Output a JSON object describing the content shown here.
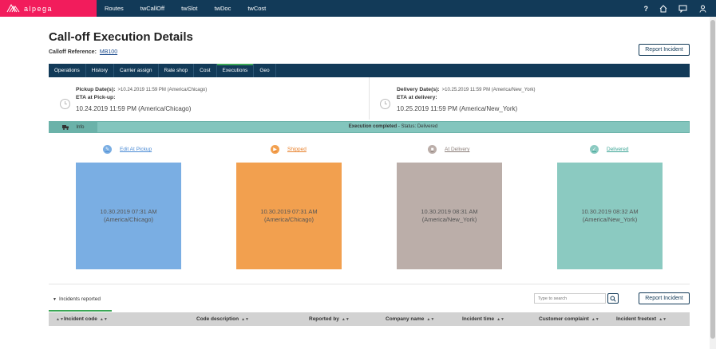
{
  "brand": {
    "name": "alpega",
    "color": "#f21c5c"
  },
  "topnav": {
    "items": [
      "Routes",
      "twCallOff",
      "twSlot",
      "twDoc",
      "twCost"
    ]
  },
  "topicons": [
    "help-icon",
    "home-icon",
    "messages-icon",
    "user-icon"
  ],
  "page": {
    "title": "Call-off Execution Details",
    "ref_label": "Calloff Reference:",
    "ref_value": "MB100",
    "report_incident_label": "Report Incident"
  },
  "tabs": [
    "Operations",
    "History",
    "Carrier assign",
    "Rate shop",
    "Cost",
    "Executions",
    "Geo"
  ],
  "active_tab": "Executions",
  "pickup": {
    "date_label": "Pickup Date(s):",
    "date_value": ">10.24.2019 11:59 PM (America/Chicago)",
    "eta_label": "ETA at Pick-up:",
    "eta_value": "10.24.2019 11:59 PM (America/Chicago)"
  },
  "delivery": {
    "date_label": "Delivery Date(s):",
    "date_value": ">10.25.2019 11:59 PM (America/New_York)",
    "eta_label": "ETA at delivery:",
    "eta_value": "10.25.2019 11:59 PM (America/New_York)"
  },
  "status": {
    "info_label": "Info",
    "message_bold": "Execution completed",
    "message_rest": " - Status: Delivered"
  },
  "steps": [
    {
      "label": "Edit At Pickup",
      "time": "10.30.2019 07:31 AM",
      "tz": "(America/Chicago)",
      "color": "#7aaee3",
      "link_color": "#4a8ad4"
    },
    {
      "label": "Shipped",
      "time": "10.30.2019 07:31 AM",
      "tz": "(America/Chicago)",
      "color": "#f2a04f",
      "link_color": "#e8812c"
    },
    {
      "label": "At Delivery",
      "time": "10.30.2019 08:31 AM",
      "tz": "(America/New_York)",
      "color": "#bbaea9",
      "link_color": "#8a7d78"
    },
    {
      "label": "Delivered",
      "time": "10.30.2019 08:32 AM",
      "tz": "(America/New_York)",
      "color": "#8bcac1",
      "link_color": "#3ba495"
    }
  ],
  "incidents": {
    "toggle_label": "Incidents reported",
    "search_placeholder": "Type to search",
    "columns": [
      "Incident code",
      "Code description",
      "Reported by",
      "Company name",
      "Incident time",
      "Customer complaint",
      "Incident freetext"
    ]
  }
}
